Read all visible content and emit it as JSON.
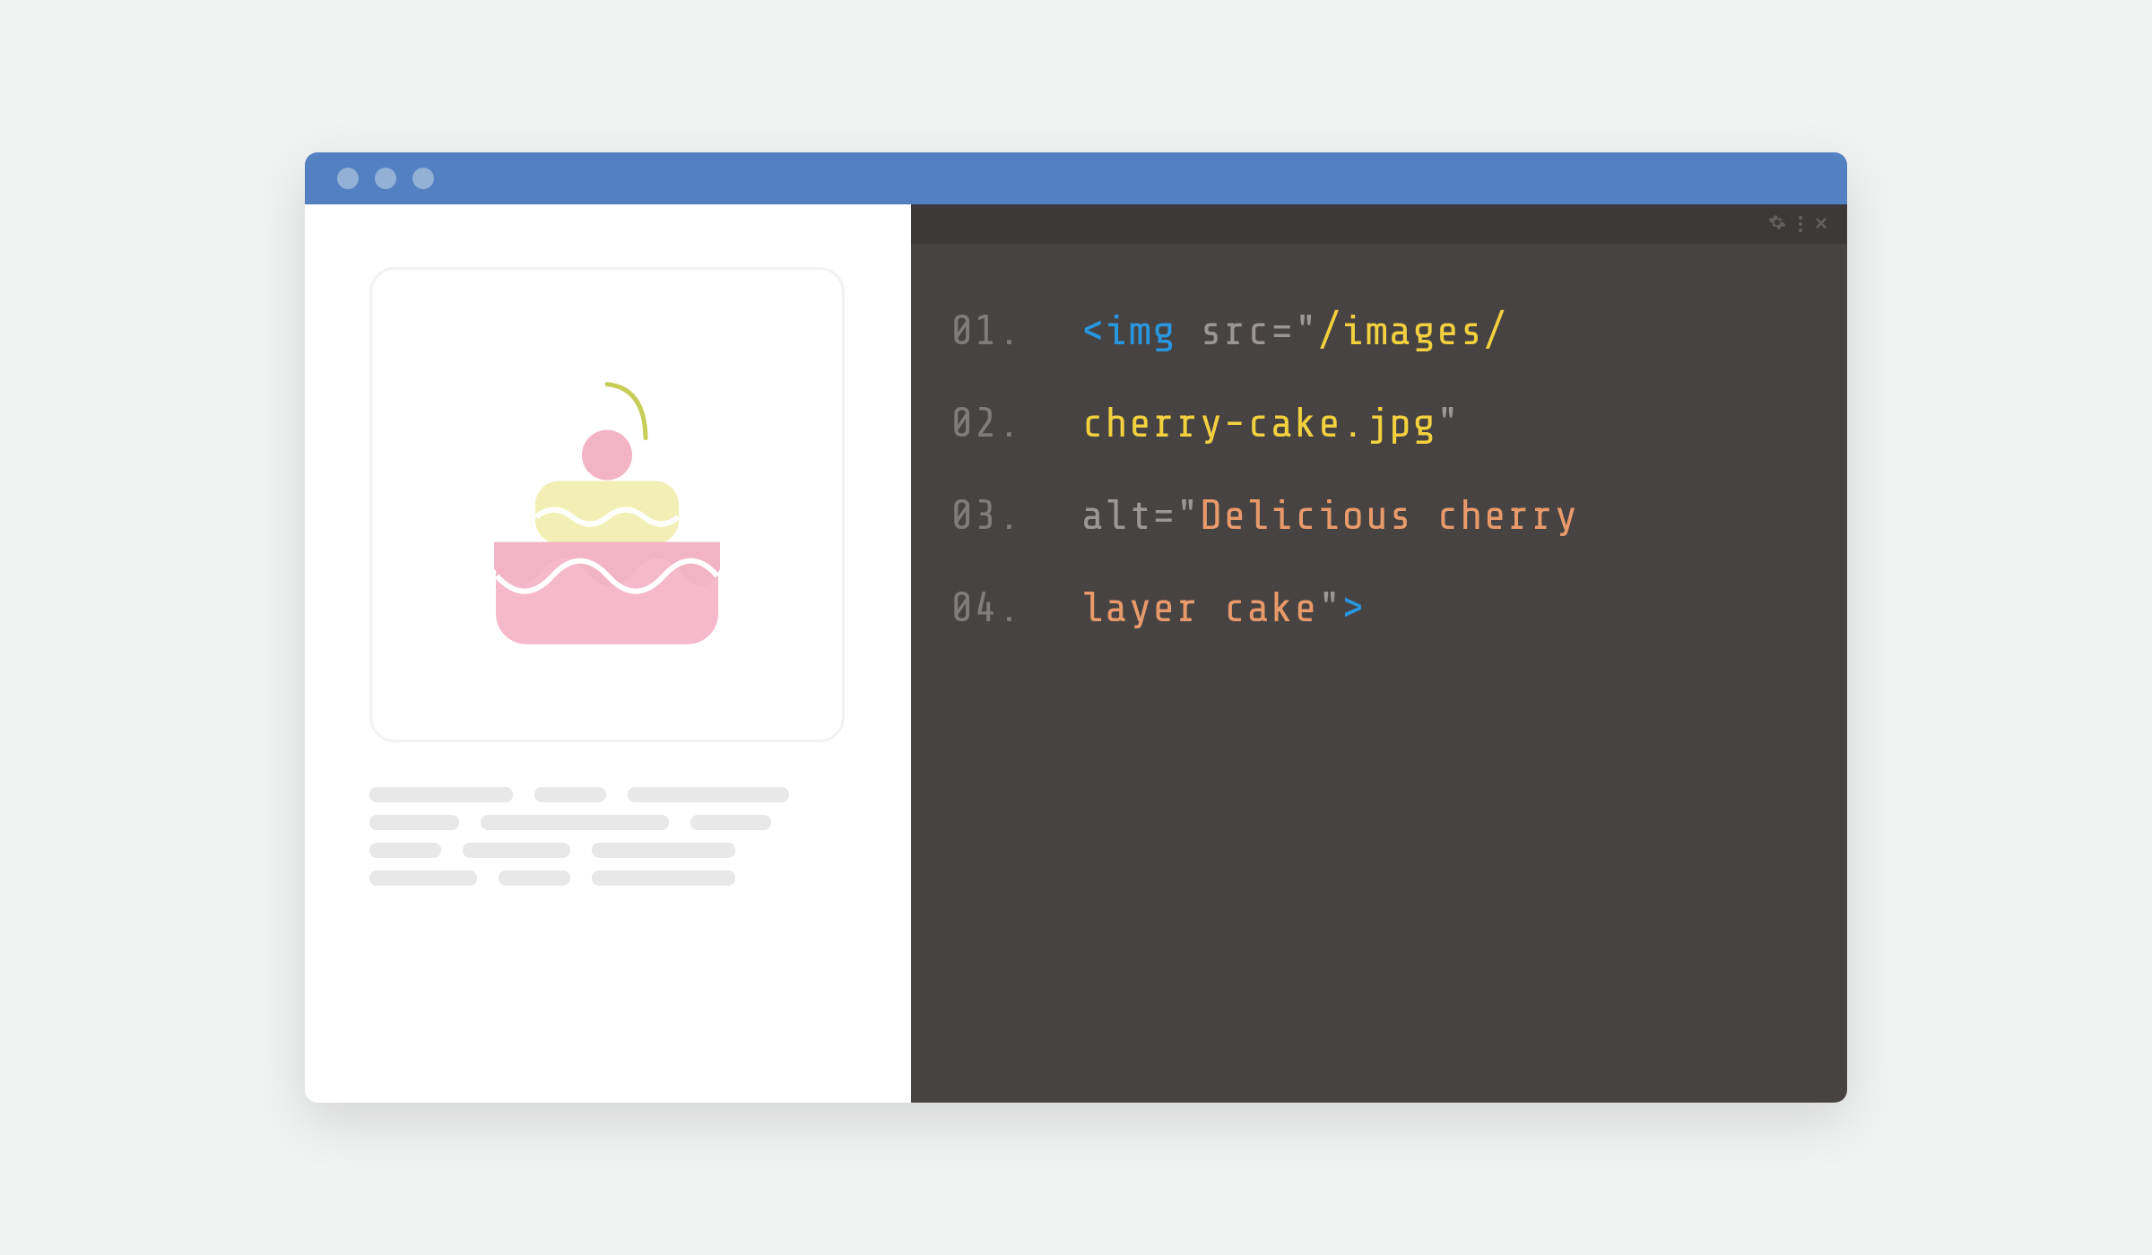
{
  "window": {
    "traffic_dots": 3
  },
  "code": {
    "lines": [
      {
        "num": "01.",
        "tokens": [
          {
            "cls": "tok-bracket",
            "t": "<"
          },
          {
            "cls": "tok-tag",
            "t": "img"
          },
          {
            "cls": "",
            "t": " "
          },
          {
            "cls": "tok-attr",
            "t": "src=\""
          },
          {
            "cls": "tok-str",
            "t": "/images/"
          }
        ]
      },
      {
        "num": "02.",
        "tokens": [
          {
            "cls": "tok-str",
            "t": "cherry-cake.jpg"
          },
          {
            "cls": "tok-attr",
            "t": "\""
          }
        ]
      },
      {
        "num": "03.",
        "tokens": [
          {
            "cls": "tok-attr",
            "t": "alt=\""
          },
          {
            "cls": "tok-alt",
            "t": "Delicious cherry"
          }
        ]
      },
      {
        "num": "04.",
        "tokens": [
          {
            "cls": "tok-alt",
            "t": "layer cake"
          },
          {
            "cls": "tok-attr",
            "t": "\""
          },
          {
            "cls": "tok-bracket",
            "t": ">"
          }
        ]
      }
    ]
  },
  "preview": {
    "image_alt": "Cherry cake illustration",
    "placeholder_widths": [
      160,
      80,
      180,
      100,
      210,
      90,
      80,
      120,
      160,
      120,
      80,
      160
    ]
  },
  "toolbar": {
    "gear": "gear-icon",
    "more": "more-icon",
    "close": "close-icon"
  }
}
